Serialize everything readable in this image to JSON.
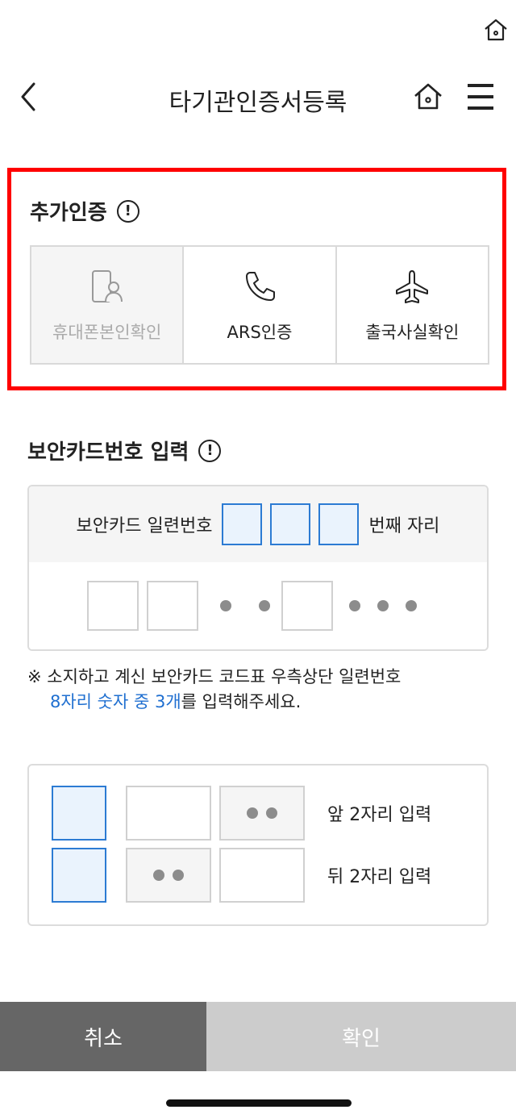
{
  "header": {
    "title": "타기관인증서등록"
  },
  "additional_auth": {
    "title": "추가인증",
    "options": [
      {
        "label": "휴대폰본인확인",
        "icon": "phone-person-icon",
        "selected": true
      },
      {
        "label": "ARS인증",
        "icon": "phone-handset-icon",
        "selected": false
      },
      {
        "label": "출국사실확인",
        "icon": "airplane-icon",
        "selected": false
      }
    ]
  },
  "security_card": {
    "title": "보안카드번호 입력",
    "serial_prefix": "보안카드 일련번호",
    "serial_suffix": "번째 자리",
    "notice_line1": "※ 소지하고 계신 보안카드 코드표 우측상단 일련번호",
    "notice_highlight": "8자리 숫자 중 3개",
    "notice_line2_rest": "를 입력해주세요."
  },
  "example": {
    "row1_label": "앞 2자리 입력",
    "row2_label": "뒤 2자리 입력"
  },
  "footer": {
    "cancel_label": "취소",
    "confirm_label": "확인"
  },
  "colors": {
    "highlight_border": "#ff0000",
    "accent_blue": "#1f6fd0",
    "cancel_bg": "#666666",
    "confirm_bg": "#cccccc"
  }
}
